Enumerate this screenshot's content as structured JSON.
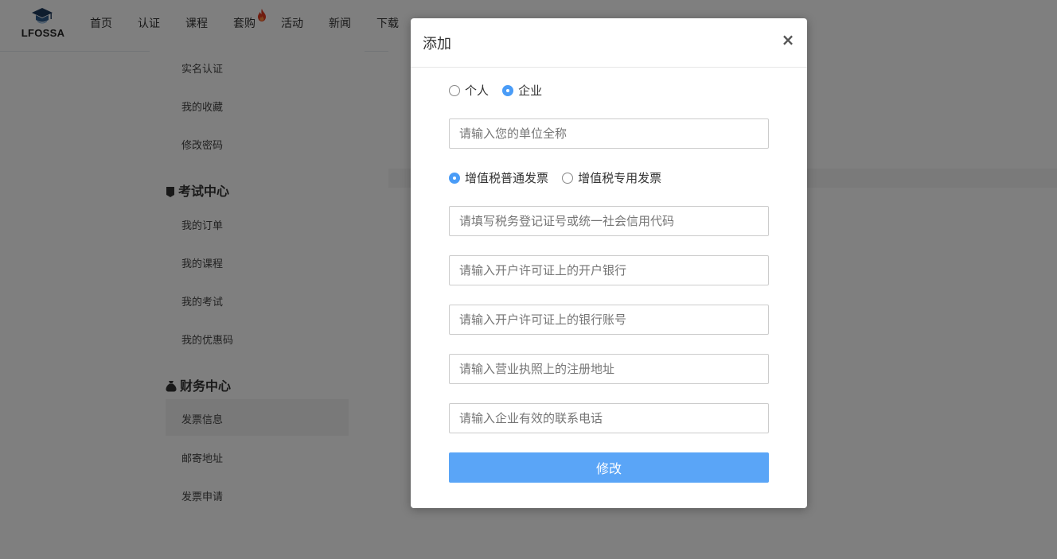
{
  "header": {
    "logo_text": "LFOSSA",
    "nav": [
      "首页",
      "认证",
      "课程",
      "套购",
      "活动",
      "新闻",
      "下载"
    ]
  },
  "sidebar": {
    "items_top": [
      "实名认证",
      "我的收藏",
      "修改密码"
    ],
    "exam_center": {
      "title": "考试中心",
      "items": [
        "我的订单",
        "我的课程",
        "我的考试",
        "我的优惠码"
      ]
    },
    "finance_center": {
      "title": "财务中心",
      "items": [
        "发票信息",
        "邮寄地址",
        "发票申请"
      ],
      "active": "发票信息"
    }
  },
  "modal": {
    "title": "添加",
    "close_symbol": "×",
    "entity_type": {
      "options": [
        "个人",
        "企业"
      ],
      "selected": "企业"
    },
    "invoice_type": {
      "options": [
        "增值税普通发票",
        "增值税专用发票"
      ],
      "selected": "增值税普通发票"
    },
    "fields": {
      "company_name": {
        "placeholder": "请输入您的单位全称",
        "value": ""
      },
      "tax_id": {
        "placeholder": "请填写税务登记证号或统一社会信用代码",
        "value": ""
      },
      "bank": {
        "placeholder": "请输入开户许可证上的开户银行",
        "value": ""
      },
      "account": {
        "placeholder": "请输入开户许可证上的银行账号",
        "value": ""
      },
      "address": {
        "placeholder": "请输入营业执照上的注册地址",
        "value": ""
      },
      "phone": {
        "placeholder": "请输入企业有效的联系电话",
        "value": ""
      }
    },
    "submit_label": "修改"
  },
  "colors": {
    "accent": "#5aa5f7",
    "radio_checked": "#4a9cf7",
    "overlay": "rgba(0,0,0,0.5)",
    "hot_icon": "#e03a1e"
  }
}
